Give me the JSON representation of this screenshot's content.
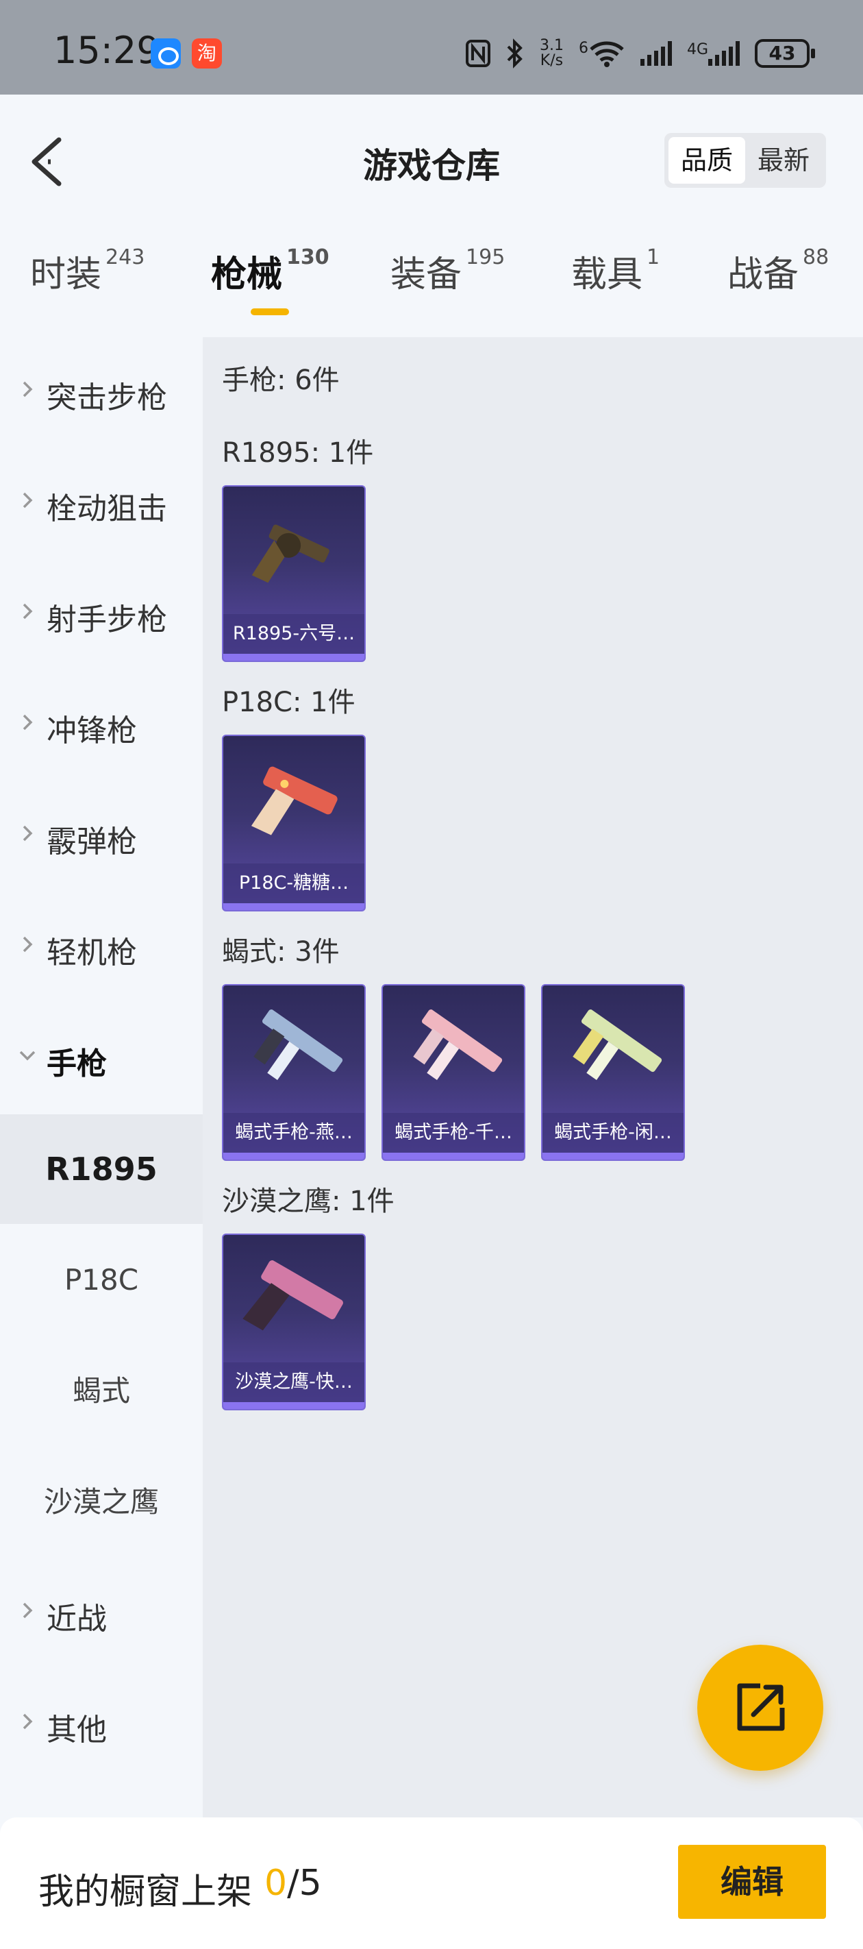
{
  "status_bar": {
    "time": "15:29",
    "app_icons": [
      "chat-bubble-icon",
      "taobao-icon"
    ],
    "app2_glyph": "淘",
    "net_speed_value": "3.1",
    "net_speed_unit": "K/s",
    "wifi_prefix": "6",
    "cell_label": "4G",
    "battery": "43"
  },
  "header": {
    "title": "游戏仓库",
    "sort_options": [
      "品质",
      "最新"
    ],
    "sort_selected": "品质"
  },
  "tabs": [
    {
      "label": "时装",
      "count": "243"
    },
    {
      "label": "枪械",
      "count": "130"
    },
    {
      "label": "装备",
      "count": "195"
    },
    {
      "label": "载具",
      "count": "1"
    },
    {
      "label": "战备",
      "count": "88"
    }
  ],
  "active_tab": "枪械",
  "sidebar": {
    "categories": [
      {
        "label": "突击步枪"
      },
      {
        "label": "栓动狙击"
      },
      {
        "label": "射手步枪"
      },
      {
        "label": "冲锋枪"
      },
      {
        "label": "霰弹枪"
      },
      {
        "label": "轻机枪"
      },
      {
        "label": "手枪"
      }
    ],
    "subcategories": [
      {
        "label": "R1895"
      },
      {
        "label": "P18C"
      },
      {
        "label": "蝎式"
      },
      {
        "label": "沙漠之鹰"
      }
    ],
    "selected_sub": "R1895",
    "after": [
      {
        "label": "近战"
      },
      {
        "label": "其他"
      }
    ]
  },
  "content": {
    "category_title": "手枪: 6件",
    "groups": [
      {
        "title": "R1895: 1件",
        "items": [
          {
            "name": "R1895-六号…",
            "color": "#5a4a30"
          }
        ]
      },
      {
        "title": "P18C: 1件",
        "items": [
          {
            "name": "P18C-糖糖…",
            "color": "#e4604f"
          }
        ]
      },
      {
        "title": "蝎式: 3件",
        "items": [
          {
            "name": "蝎式手枪-燕…",
            "color": "#9fb6d6"
          },
          {
            "name": "蝎式手枪-千…",
            "color": "#f0b6c0"
          },
          {
            "name": "蝎式手枪-闲…",
            "color": "#d9e6b0"
          }
        ]
      },
      {
        "title": "沙漠之鹰: 1件",
        "items": [
          {
            "name": "沙漠之鹰-快…",
            "color": "#d27aa6"
          }
        ]
      }
    ]
  },
  "bottom_bar": {
    "label": "我的橱窗上架",
    "count_current": "0",
    "count_sep": "/",
    "count_total": "5",
    "edit_label": "编辑"
  },
  "colors": {
    "accent": "#f7b500",
    "card_top": "#2e2a5a",
    "card_bottom": "#5a4aa6"
  }
}
